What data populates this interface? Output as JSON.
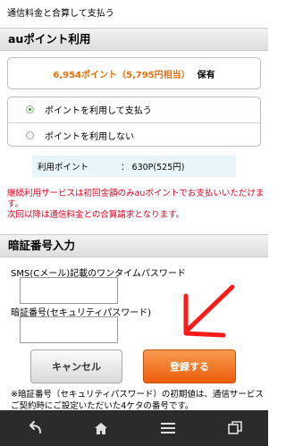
{
  "top_text": "通信料金と合算して支払う",
  "au_points": {
    "header": "auポイント利用",
    "points_value": "6,954ポイント（5,795円相当）",
    "points_label": "保有"
  },
  "payment_options": [
    {
      "label": "ポイントを利用して支払う",
      "selected": true
    },
    {
      "label": "ポイントを利用しない",
      "selected": false
    }
  ],
  "usage": {
    "label": "利用ポイント",
    "value": "：  630P(525円)"
  },
  "notice": {
    "line1": "継続利用サービスは初回金額のみauポイントでお支払いいただけます。",
    "line2": "次回以降は通信料金との合算請求となります。"
  },
  "pin_section": {
    "header": "暗証番号入力",
    "sms_label": "SMS(Cメール)記載のワンタイムパスワード",
    "sms_value": "",
    "pin_label": "暗証番号(セキュリティパスワード)",
    "pin_value": ""
  },
  "buttons": {
    "cancel": "キャンセル",
    "register": "登録する"
  },
  "footnote": "※暗証番号（セキュリティパスワード）の初期値は、通信サービスご契約時にご設定いただいた4ケタの番号です。",
  "colors": {
    "accent_orange": "#ec5c0b",
    "notice_red": "#e0001e",
    "arrow_red": "#ff1a1a",
    "nav_bar": "#2b2b2b"
  },
  "nav_icons": [
    "back-icon",
    "home-icon",
    "menu-icon",
    "recent-apps-icon"
  ]
}
